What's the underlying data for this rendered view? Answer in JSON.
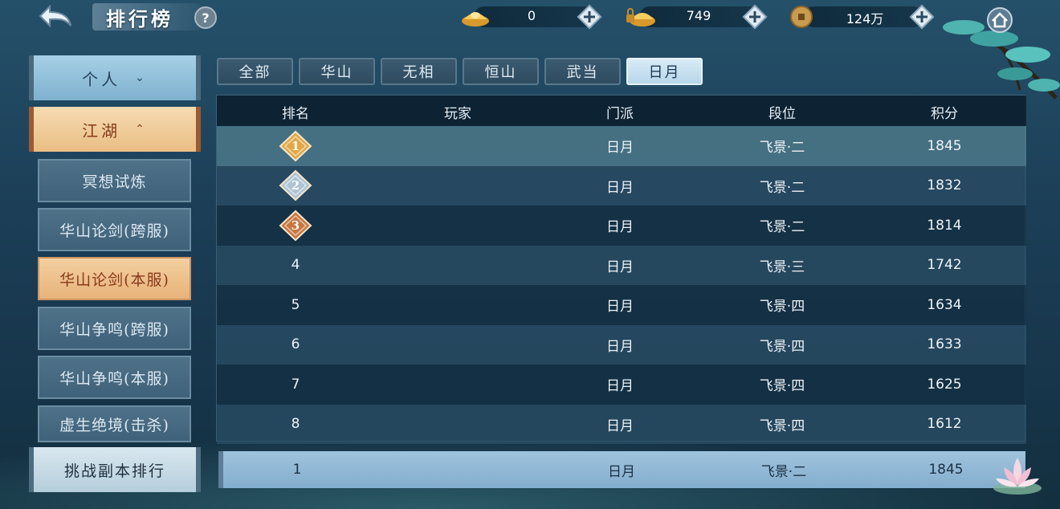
{
  "header": {
    "title": "排行榜",
    "help_label": "?",
    "currencies": [
      {
        "name": "gold-ingot",
        "value": "0"
      },
      {
        "name": "bound-ingot",
        "value": "749"
      },
      {
        "name": "coin",
        "value": "124万"
      }
    ]
  },
  "sidebar": {
    "personal": {
      "label": "个人",
      "chevron": "chevron-down-icon"
    },
    "jianghu": {
      "label": "江湖",
      "chevron": "chevron-up-icon"
    },
    "items": [
      {
        "label": "冥想试炼",
        "active": false
      },
      {
        "label": "华山论剑(跨服)",
        "active": false
      },
      {
        "label": "华山论剑(本服)",
        "active": true
      },
      {
        "label": "华山争鸣(跨服)",
        "active": false
      },
      {
        "label": "华山争鸣(本服)",
        "active": false
      },
      {
        "label": "虚生绝境(击杀)",
        "active": false
      }
    ],
    "challenge": "挑战副本排行"
  },
  "tabs": [
    {
      "label": "全部",
      "active": false
    },
    {
      "label": "华山",
      "active": false
    },
    {
      "label": "无相",
      "active": false
    },
    {
      "label": "恒山",
      "active": false
    },
    {
      "label": "武当",
      "active": false
    },
    {
      "label": "日月",
      "active": true
    }
  ],
  "table": {
    "headers": {
      "rank": "排名",
      "player": "玩家",
      "sect": "门派",
      "tier": "段位",
      "score": "积分"
    },
    "rows": [
      {
        "rank": "1",
        "player": "",
        "sect": "日月",
        "tier": "飞景·二",
        "score": "1845"
      },
      {
        "rank": "2",
        "player": "",
        "sect": "日月",
        "tier": "飞景·二",
        "score": "1832"
      },
      {
        "rank": "3",
        "player": "",
        "sect": "日月",
        "tier": "飞景·二",
        "score": "1814"
      },
      {
        "rank": "4",
        "player": "",
        "sect": "日月",
        "tier": "飞景·三",
        "score": "1742"
      },
      {
        "rank": "5",
        "player": "",
        "sect": "日月",
        "tier": "飞景·四",
        "score": "1634"
      },
      {
        "rank": "6",
        "player": "",
        "sect": "日月",
        "tier": "飞景·四",
        "score": "1633"
      },
      {
        "rank": "7",
        "player": "",
        "sect": "日月",
        "tier": "飞景·四",
        "score": "1625"
      },
      {
        "rank": "8",
        "player": "",
        "sect": "日月",
        "tier": "飞景·四",
        "score": "1612"
      }
    ]
  },
  "my_rank": {
    "rank": "1",
    "player": "",
    "sect": "日月",
    "tier": "飞景·二",
    "score": "1845"
  },
  "colors": {
    "gold_medal": "#e2a748",
    "silver_medal": "#aec3d3",
    "bronze_medal": "#c9763e",
    "active_tab": "#c9e2f1",
    "active_item": "#efc48e"
  }
}
